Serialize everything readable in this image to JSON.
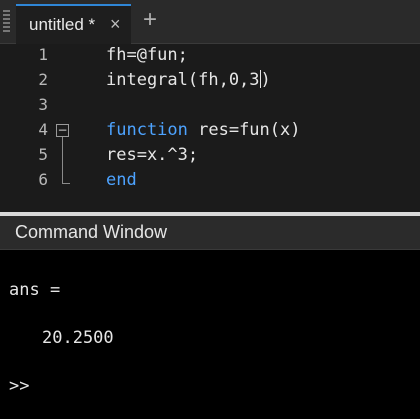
{
  "tab": {
    "title": "untitled *",
    "close_glyph": "×",
    "add_glyph": "+"
  },
  "editor": {
    "line_numbers": [
      "1",
      "2",
      "3",
      "4",
      "5",
      "6"
    ],
    "fold_glyph": "−",
    "lines": {
      "l1": "fh=@fun;",
      "l2": "integral(fh,0,3",
      "l2_close": ")",
      "l4_kw": "function",
      "l4_rest": " res=fun(x)",
      "l5": "res=x.^3;",
      "l6_kw": "end"
    },
    "keyword_color": "#4da3ff"
  },
  "command_window": {
    "title": "Command Window",
    "output_label": "ans =",
    "output_value": "20.2500",
    "prompt": ">>"
  }
}
